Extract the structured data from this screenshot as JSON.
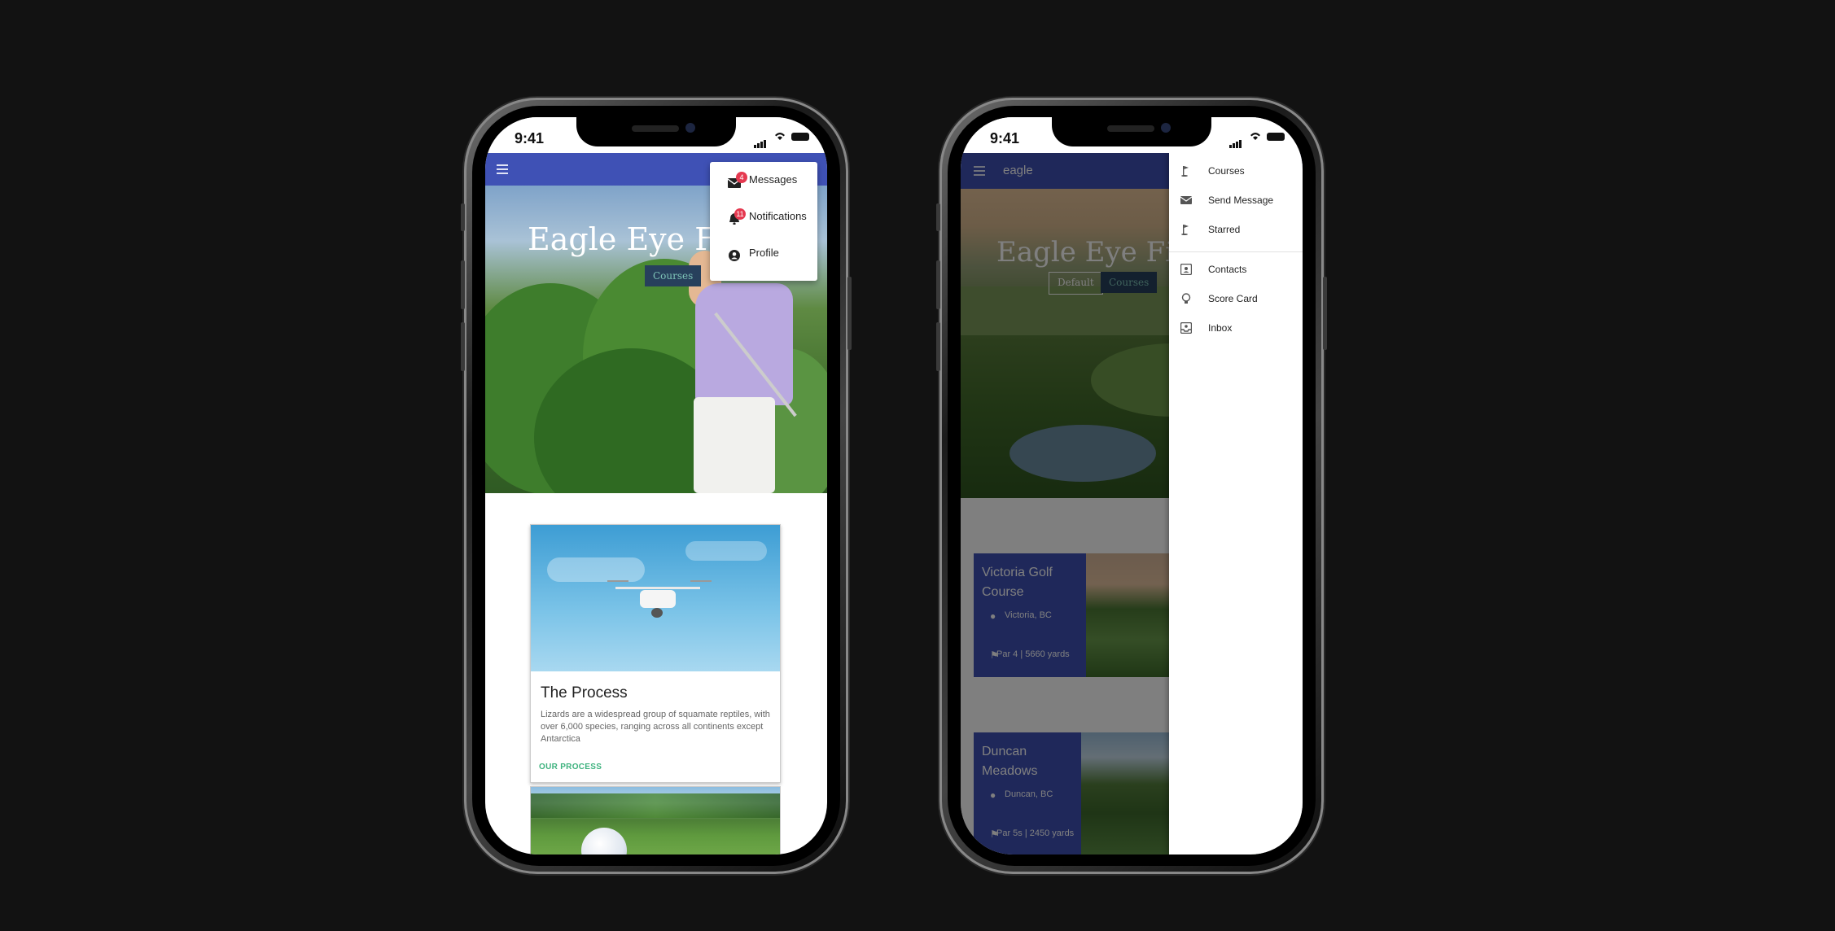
{
  "status_bar": {
    "time": "9:41"
  },
  "phone1": {
    "hero": {
      "title": "Eagle Eye Fil",
      "button": "Courses"
    },
    "dropdown": [
      {
        "label": "Messages",
        "badge": "4",
        "icon": "mail-icon"
      },
      {
        "label": "Notifications",
        "badge": "11",
        "icon": "bell-icon"
      },
      {
        "label": "Profile",
        "badge": "",
        "icon": "account-circle-icon"
      }
    ],
    "card": {
      "title": "The Process",
      "text": "Lizards are a widespread group of squamate reptiles, with over 6,000 species, ranging across all continents except Antarctica",
      "link": "OUR PROCESS"
    }
  },
  "phone2": {
    "app_title": "eagle",
    "hero": {
      "title": "Eagle Eye Fil",
      "button_default": "Default",
      "button_courses": "Courses"
    },
    "courses": [
      {
        "title": "Victoria Golf Course",
        "location": "Victoria, BC",
        "details": "Par 4 | 5660 yards"
      },
      {
        "title": "Duncan Meadows",
        "location": "Duncan, BC",
        "details": "Par 5s | 2450 yards"
      }
    ],
    "drawer": {
      "items": [
        {
          "label": "Courses",
          "icon": "golf-flag-icon"
        },
        {
          "label": "Send Message",
          "icon": "mail-icon"
        },
        {
          "label": "Starred",
          "icon": "golf-flag-icon"
        }
      ],
      "items2": [
        {
          "label": "Contacts",
          "icon": "contacts-icon"
        },
        {
          "label": "Score Card",
          "icon": "lightbulb-icon"
        },
        {
          "label": "Inbox",
          "icon": "inbox-icon"
        }
      ]
    }
  },
  "colors": {
    "primary": "#3f51b5",
    "badge": "#e53950",
    "link": "#3fb37f",
    "background": "#121212"
  }
}
